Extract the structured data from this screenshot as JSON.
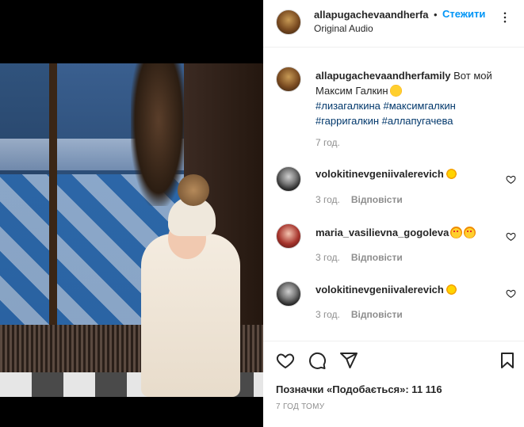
{
  "post": {
    "username_header": "allapugachevaandherfa",
    "separator": "•",
    "follow_label": "Стежити",
    "audio_label": "Original Audio"
  },
  "caption": {
    "username": "allapugachevaandherfamily",
    "text": "Вот мой Максим Галкин",
    "hashtags_line1": "#лизагалкина #максимгалкин",
    "hashtags_line2": "#гарригалкин #аллапугачева",
    "time": "7 год."
  },
  "comments": [
    {
      "username": "volokitinevgeniivalerevich",
      "time": "3 год.",
      "reply_label": "Відповісти",
      "emoji": "sun-emoji"
    },
    {
      "username": "maria_vasilievna_gogoleva",
      "time": "3 год.",
      "reply_label": "Відповісти",
      "emoji": "star-eyes-emoji"
    },
    {
      "username": "volokitinevgeniivalerevich",
      "time": "3 год.",
      "reply_label": "Відповісти",
      "emoji": "sun-emoji"
    }
  ],
  "footer": {
    "likes_text": "Позначки «Подобається»: 11 116",
    "post_time": "7 ГОД ТОМУ"
  },
  "icons": {
    "more": "more-horizontal-icon",
    "like": "heart-icon",
    "comment": "comment-icon",
    "share": "paper-plane-icon",
    "save": "bookmark-icon"
  },
  "colors": {
    "link_blue": "#0095f6",
    "hashtag": "#00376b",
    "secondary_text": "#8e8e8e"
  }
}
